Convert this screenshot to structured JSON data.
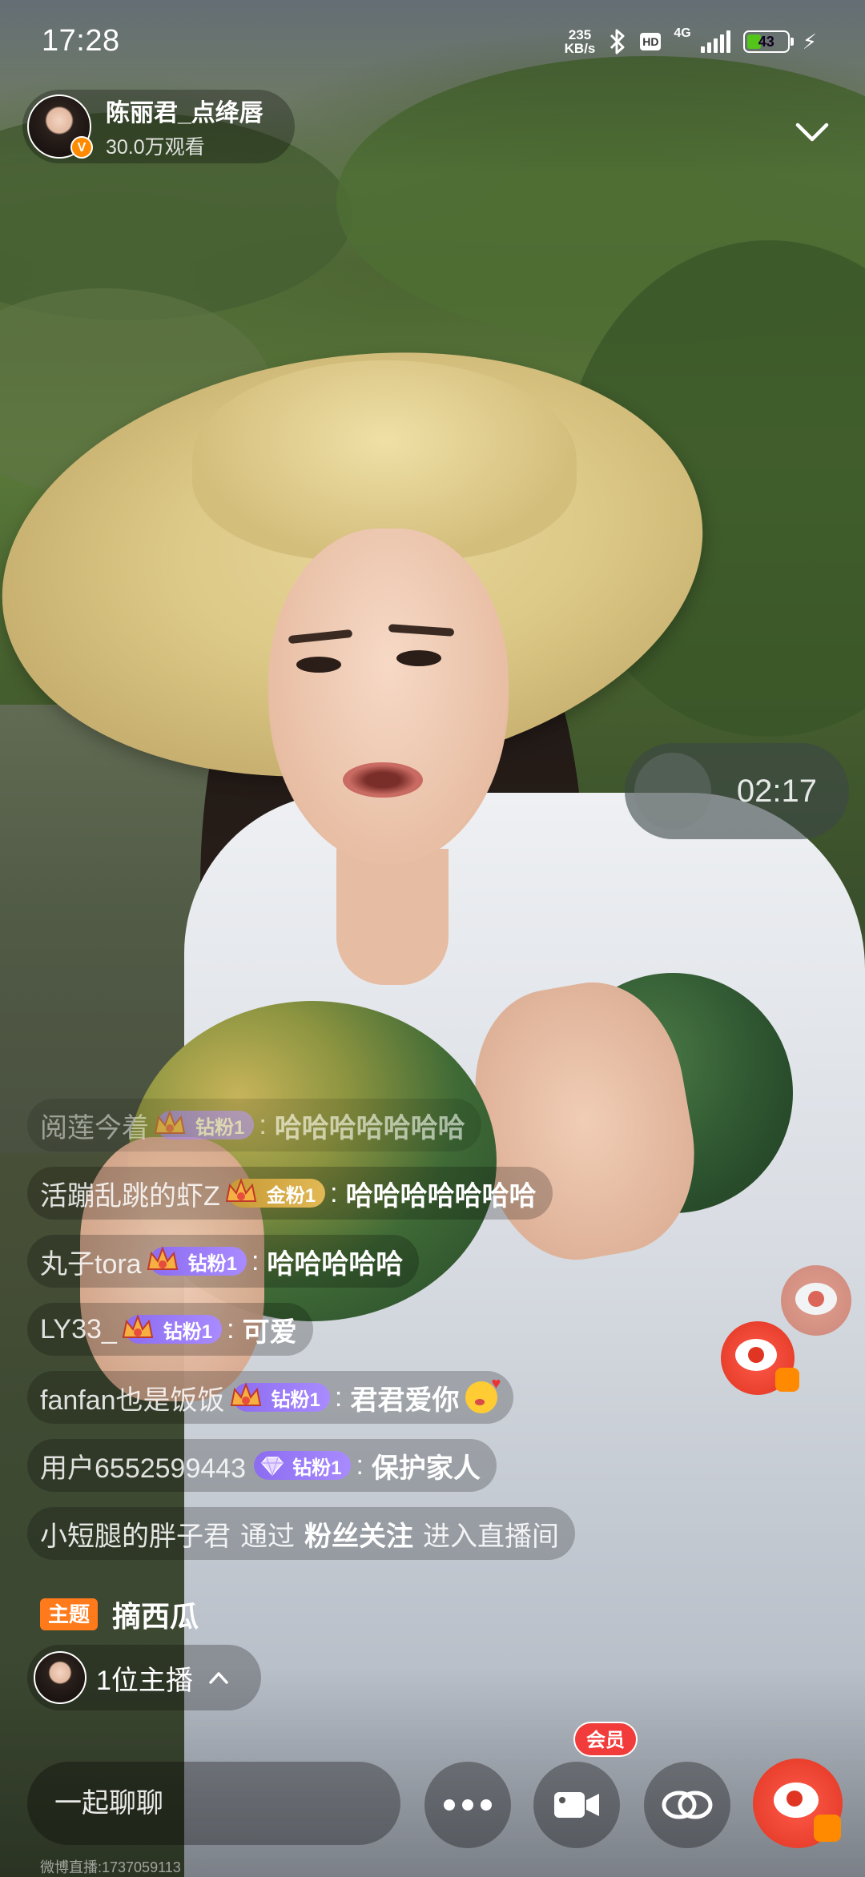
{
  "status_bar": {
    "time": "17:28",
    "net_speed_value": "235",
    "net_speed_unit": "KB/s",
    "hd_label": "HD",
    "network_type": "4G",
    "battery": "43",
    "battery_fraction": 0.43
  },
  "host": {
    "name": "陈丽君_点绛唇",
    "viewers": "30.0万观看",
    "verified_label": "V"
  },
  "timer": "02:17",
  "chat": [
    {
      "user": "阅莲今着",
      "badge": "钻粉1",
      "badge_type": "diamond-crown",
      "text": "哈哈哈哈哈哈哈"
    },
    {
      "user": "活蹦乱跳的虾Z",
      "badge": "金粉1",
      "badge_type": "gold-crown",
      "text": "哈哈哈哈哈哈哈"
    },
    {
      "user": "丸子tora",
      "badge": "钻粉1",
      "badge_type": "diamond-crown",
      "text": "哈哈哈哈哈"
    },
    {
      "user": "LY33_",
      "badge": "钻粉1",
      "badge_type": "diamond-crown",
      "text": "可爱"
    },
    {
      "user": "fanfan也是饭饭",
      "badge": "钻粉1",
      "badge_type": "diamond-crown",
      "text": "君君爱你"
    },
    {
      "user": "用户6552599443",
      "badge": "钻粉1",
      "badge_type": "diamond-gem",
      "text": "保护家人"
    }
  ],
  "join_notice": {
    "user": "小短腿的胖子君",
    "via": "通过",
    "source": "粉丝关注",
    "action": "进入直播间"
  },
  "topic": {
    "tag": "主题",
    "text": "摘西瓜"
  },
  "host_count": "1位主播",
  "bottom_bar": {
    "chat_placeholder": "一起聊聊",
    "vip_label": "会员"
  },
  "watermark": "微博直播:1737059113",
  "colors": {
    "weibo_red": "#e03522",
    "topic_orange": "#ff7a1a",
    "diamond_badge": "#8c6cf0",
    "gold_badge": "#c79a35",
    "vip_red": "#f23b3b"
  }
}
